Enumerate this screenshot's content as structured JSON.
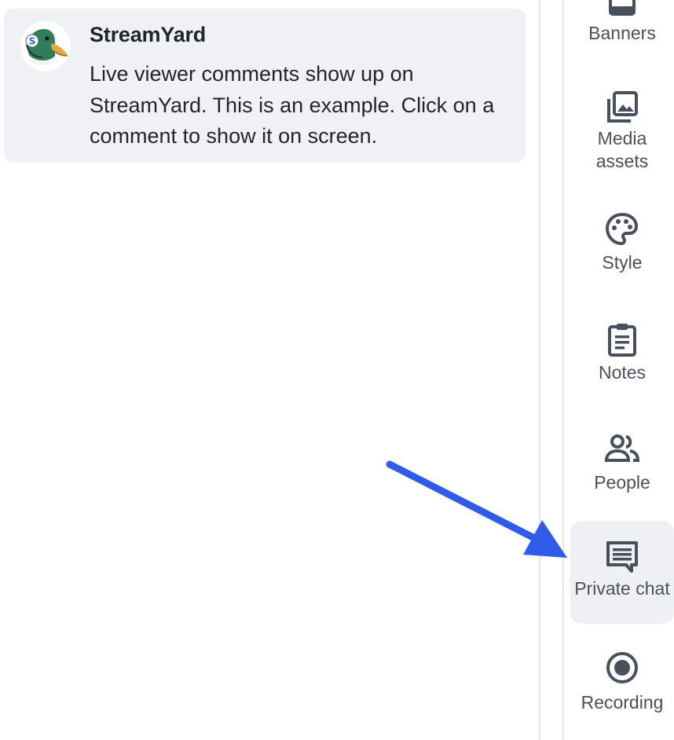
{
  "comment": {
    "author": "StreamYard",
    "text": "Live viewer comments show up on StreamYard. This is an example. Click on a comment to show it on screen."
  },
  "sidebar": {
    "items": [
      {
        "label": "Banners",
        "icon": "banner-icon"
      },
      {
        "label": "Media assets",
        "icon": "media-assets-icon"
      },
      {
        "label": "Style",
        "icon": "palette-icon"
      },
      {
        "label": "Notes",
        "icon": "clipboard-icon"
      },
      {
        "label": "People",
        "icon": "people-icon"
      },
      {
        "label": "Private chat",
        "icon": "chat-icon",
        "active": true
      },
      {
        "label": "Recording",
        "icon": "record-icon"
      }
    ]
  },
  "colors": {
    "accent_arrow": "#2f5bea",
    "icon": "#4a4f5c",
    "card_bg": "#f0f1f4",
    "active_bg": "#eef0f3"
  }
}
